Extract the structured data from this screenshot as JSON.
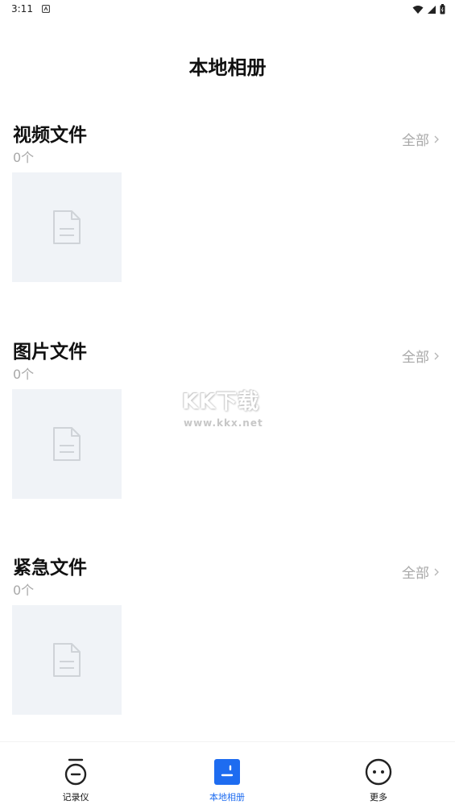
{
  "status_bar": {
    "time": "3:11"
  },
  "page": {
    "title": "本地相册"
  },
  "sections": [
    {
      "title": "视频文件",
      "count": "0个",
      "see_all": "全部"
    },
    {
      "title": "图片文件",
      "count": "0个",
      "see_all": "全部"
    },
    {
      "title": "紧急文件",
      "count": "0个",
      "see_all": "全部"
    }
  ],
  "watermark": {
    "logo": "KK下载",
    "url": "www.kkx.net"
  },
  "tabbar": {
    "items": [
      {
        "label": "记录仪",
        "icon": "recorder-icon"
      },
      {
        "label": "本地相册",
        "icon": "album-icon",
        "active": true
      },
      {
        "label": "更多",
        "icon": "more-icon"
      }
    ],
    "active_color": "#1e6cf0"
  }
}
